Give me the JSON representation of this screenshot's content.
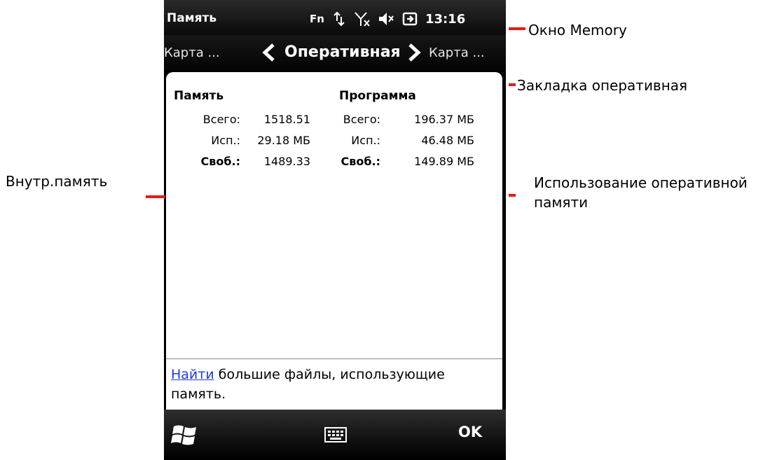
{
  "status_bar": {
    "title": "Память",
    "fn_label": "Fn",
    "time": "13:16",
    "icons": [
      "data-sync-icon",
      "no-signal-icon",
      "speaker-muted-icon",
      "battery-charging-icon"
    ]
  },
  "pivot": {
    "left_label": "Карта ...",
    "current_label": "Оперативная",
    "right_label": "Карта ..."
  },
  "memory": {
    "header": "Память",
    "total_label": "Всего:",
    "total_value": "1518.51",
    "used_label": "Исп.:",
    "used_value": "29.18 МБ",
    "free_label": "Своб.:",
    "free_value": "1489.33"
  },
  "program": {
    "header": "Программа",
    "total_label": "Всего:",
    "total_value": "196.37 МБ",
    "used_label": "Исп.:",
    "used_value": "46.48 МБ",
    "free_label": "Своб.:",
    "free_value": "149.89 МБ"
  },
  "find": {
    "link_text": "Найти",
    "rest_text": " большие файлы, использующие память."
  },
  "softkeys": {
    "right_label": "OK",
    "left_icon": "windows-logo-icon",
    "center_icon": "keyboard-icon"
  },
  "annotations": {
    "memory_window": "Окно Memory",
    "ram_tab": "Закладка оперативная",
    "internal_memory": "Внутр.память",
    "ram_usage_line1": "Использование оперативной",
    "ram_usage_line2": "памяти"
  },
  "colors": {
    "annotation_line": "#e41b1b",
    "link": "#1f3bdb"
  }
}
